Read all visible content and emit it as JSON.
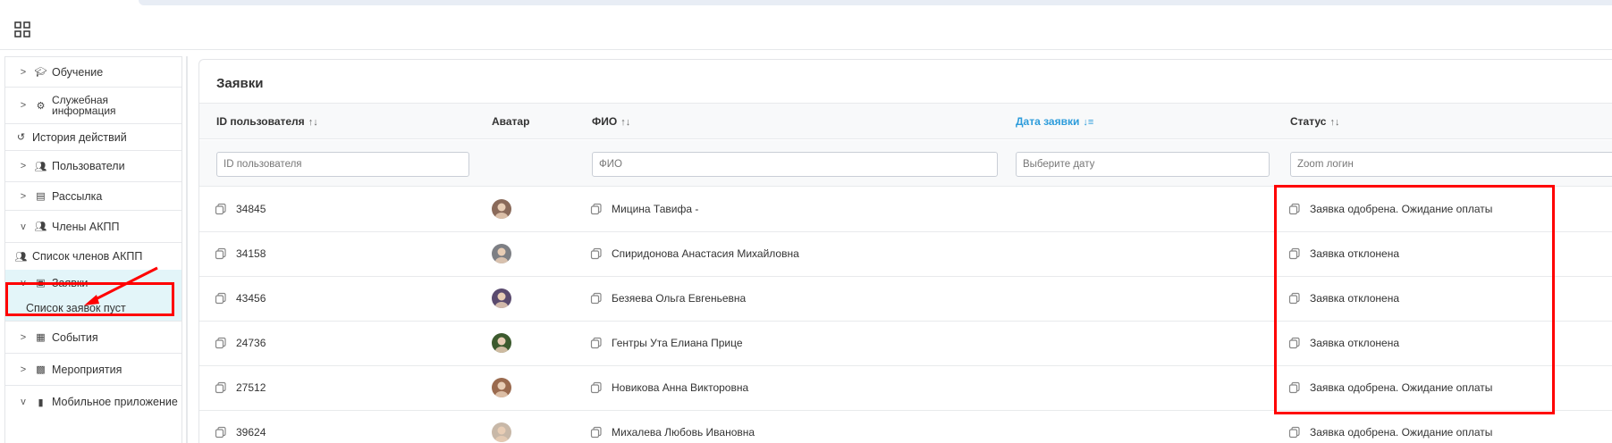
{
  "header": {
    "apps_icon": "grid-icon"
  },
  "sidebar": {
    "items": [
      {
        "label": "Обучение",
        "icon": "graduation-cap-icon",
        "expanded": false
      },
      {
        "label": "Служебная информация",
        "icon": "gears-icon",
        "expanded": false
      },
      {
        "label": "История действий",
        "icon": "history-icon",
        "expanded": null
      },
      {
        "label": "Пользователи",
        "icon": "users-icon",
        "expanded": false
      },
      {
        "label": "Рассылка",
        "icon": "newspaper-icon",
        "expanded": false
      },
      {
        "label": "Члены АКПП",
        "icon": "user-group-icon",
        "expanded": true
      },
      {
        "label": "Список членов АКПП",
        "icon": "users-icon",
        "expanded": null
      },
      {
        "label": "Заявки",
        "icon": "id-card-icon",
        "expanded": true
      },
      {
        "label": "Список заявок пуст",
        "icon": "",
        "expanded": null
      },
      {
        "label": "События",
        "icon": "calendar-icon",
        "expanded": false
      },
      {
        "label": "Мероприятия",
        "icon": "calendar-filled-icon",
        "expanded": false
      },
      {
        "label": "Мобильное приложение",
        "icon": "mobile-icon",
        "expanded": true
      }
    ],
    "sidebar_item_label_1a": "Служебная",
    "sidebar_item_label_1b": "информация"
  },
  "main": {
    "title": "Заявки",
    "columns": [
      {
        "label": "ID пользователя",
        "sort": "↑↓",
        "active": false
      },
      {
        "label": "Аватар",
        "sort": "",
        "active": false
      },
      {
        "label": "ФИО",
        "sort": "↑↓",
        "active": false
      },
      {
        "label": "Дата заявки",
        "sort": "↓≡",
        "active": true
      },
      {
        "label": "Статус",
        "sort": "↑↓",
        "active": false
      }
    ],
    "filters": {
      "id_placeholder": "ID пользователя",
      "fio_placeholder": "ФИО",
      "date_placeholder": "Выберите дату",
      "status_placeholder": "Zoom логин"
    },
    "rows": [
      {
        "id": "34845",
        "fio": "Мицина Тавифа -",
        "status": "Заявка одобрена. Ожидание оплаты"
      },
      {
        "id": "34158",
        "fio": "Спиридонова Анастасия Михайловна",
        "status": "Заявка отклонена"
      },
      {
        "id": "43456",
        "fio": "Безяева Ольга Евгеньевна",
        "status": "Заявка отклонена"
      },
      {
        "id": "24736",
        "fio": "Гентры Ута Елиана Прице",
        "status": "Заявка отклонена"
      },
      {
        "id": "27512",
        "fio": "Новикова Анна Викторовна",
        "status": "Заявка одобрена. Ожидание оплаты"
      },
      {
        "id": "39624",
        "fio": "Михалева Любовь Ивановна",
        "status": "Заявка одобрена. Ожидание оплаты"
      }
    ]
  },
  "colors": {
    "highlight": "#ff0000",
    "accent": "#2d9cdb",
    "submenu_bg": "#e3f5f9"
  }
}
